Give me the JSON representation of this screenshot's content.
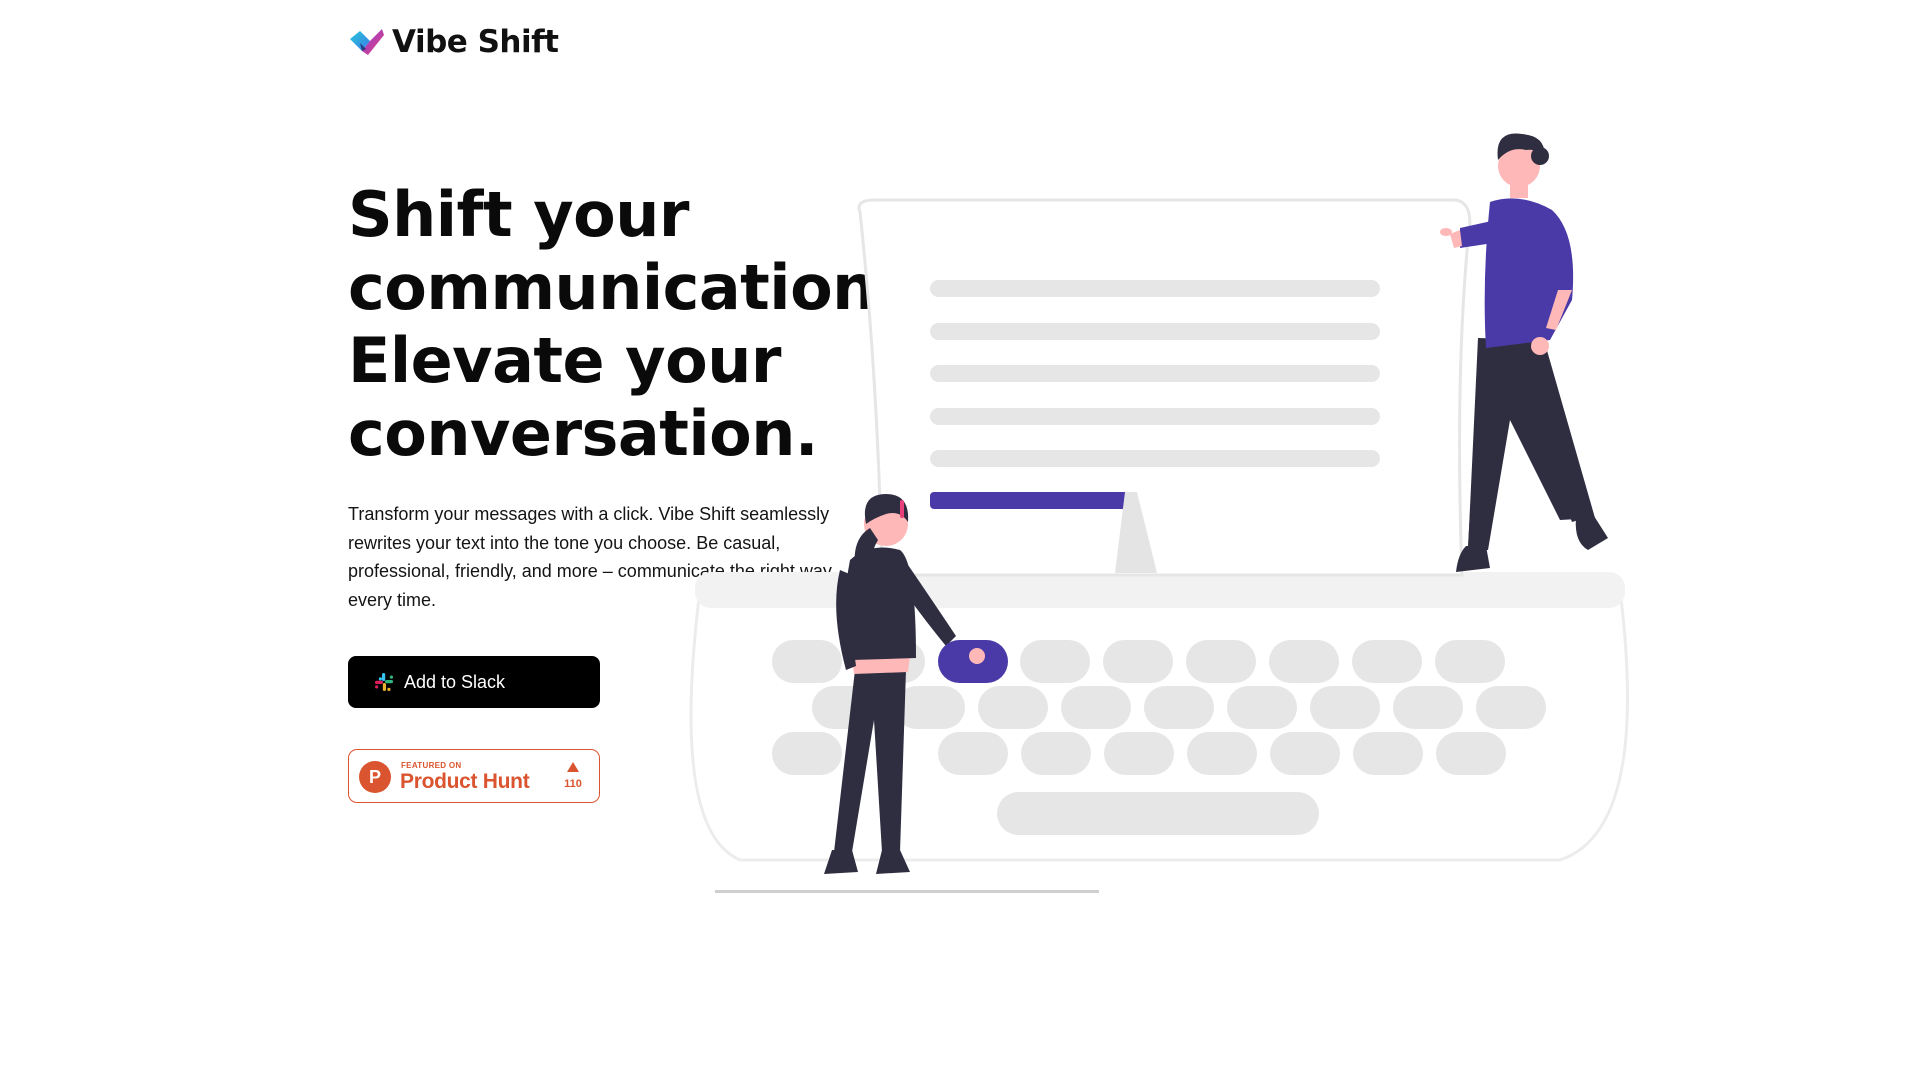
{
  "brand": {
    "name": "Vibe Shift",
    "logo_icon": "vibe-shift-logo-icon",
    "colors": [
      "#27c6d8",
      "#3b7be8",
      "#8b3fd8",
      "#e8407a"
    ]
  },
  "hero": {
    "headline_lines": [
      "Shift your",
      "communication.",
      "Elevate your",
      "conversation."
    ],
    "description": "Transform your messages with a click. Vibe Shift seamlessly rewrites your text into the tone you choose. Be casual, professional, friendly, and more – communicate the right way, every time."
  },
  "cta": {
    "slack_label": "Add to Slack",
    "slack_icon": "slack-icon"
  },
  "product_hunt": {
    "featured_label": "FEATURED ON",
    "name": "Product Hunt",
    "logo_letter": "P",
    "upvotes": "110",
    "accent": "#da552f"
  },
  "illustration": {
    "accent": "#4a3aa8",
    "description_icon": "typewriter-illustration"
  }
}
